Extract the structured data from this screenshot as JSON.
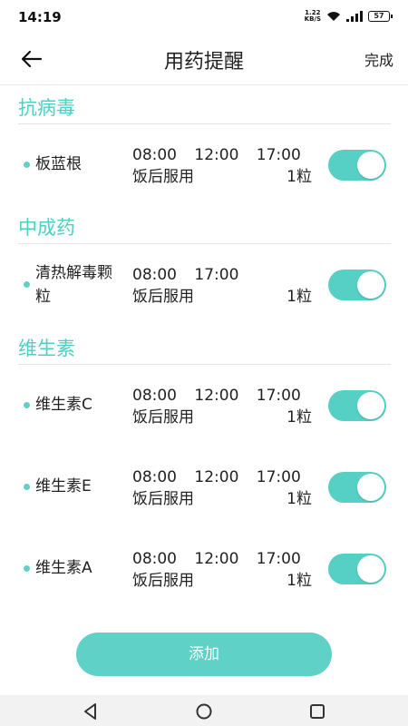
{
  "status_bar": {
    "time": "14:19",
    "net_speed_value": "1.22",
    "net_speed_unit": "KB/S",
    "battery": "57"
  },
  "header": {
    "title": "用药提醒",
    "done_label": "完成"
  },
  "sections": [
    {
      "title": "抗病毒",
      "items": [
        {
          "name": "板蓝根",
          "times": "08:00 12:00 17:00",
          "instruction": "饭后服用",
          "quantity": "1粒",
          "enabled": true
        }
      ]
    },
    {
      "title": "中成药",
      "items": [
        {
          "name_line1": "清热解毒颗",
          "name_line2": "粒",
          "times": "08:00 17:00",
          "instruction": "饭后服用",
          "quantity": "1粒",
          "enabled": true
        }
      ]
    },
    {
      "title": "维生素",
      "items": [
        {
          "name": "维生素C",
          "times": "08:00 12:00 17:00",
          "instruction": "饭后服用",
          "quantity": "1粒",
          "enabled": true
        },
        {
          "name": "维生素E",
          "times": "08:00 12:00 17:00",
          "instruction": "饭后服用",
          "quantity": "1粒",
          "enabled": true
        },
        {
          "name": "维生素A",
          "times": "08:00 12:00 17:00",
          "instruction": "饭后服用",
          "quantity": "1粒",
          "enabled": true
        }
      ]
    }
  ],
  "add_button_label": "添加",
  "colors": {
    "accent": "#56d0c4",
    "section_title": "#4fcfc4"
  },
  "icons": {
    "back": "arrow-left-icon",
    "nav_back": "triangle-back-icon",
    "nav_home": "circle-home-icon",
    "nav_recent": "square-recent-icon"
  }
}
